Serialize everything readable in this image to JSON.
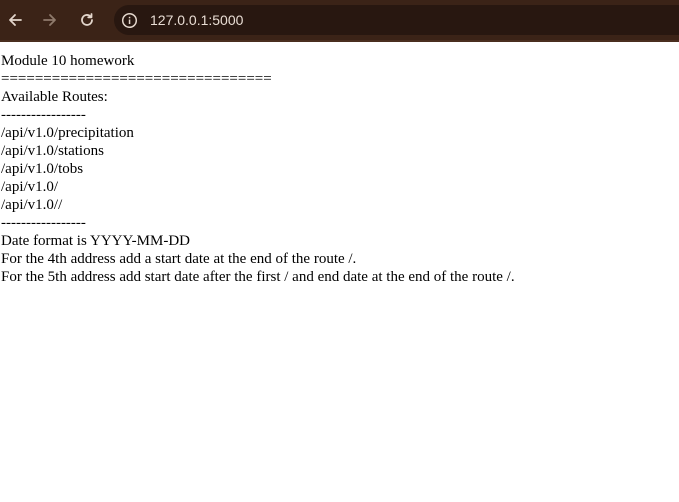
{
  "browser": {
    "url": "127.0.0.1:5000",
    "toolbar_color": "#3b2317",
    "icons": {
      "back": "arrow-left-icon",
      "forward": "arrow-right-icon",
      "reload": "reload-icon",
      "site_info": "info-icon"
    }
  },
  "page": {
    "title": "Module 10 homework",
    "separator": "================================",
    "routes_header": "Available Routes:",
    "divider_top": "-----------------",
    "routes": [
      "/api/v1.0/precipitation",
      "/api/v1.0/stations",
      "/api/v1.0/tobs",
      "/api/v1.0/",
      "/api/v1.0//"
    ],
    "divider_bottom": "-----------------",
    "notes": [
      "Date format is YYYY-MM-DD",
      "For the 4th address add a start date at the end of the route /.",
      "For the 5th address add start date after the first / and end date at the end of the route /."
    ]
  }
}
